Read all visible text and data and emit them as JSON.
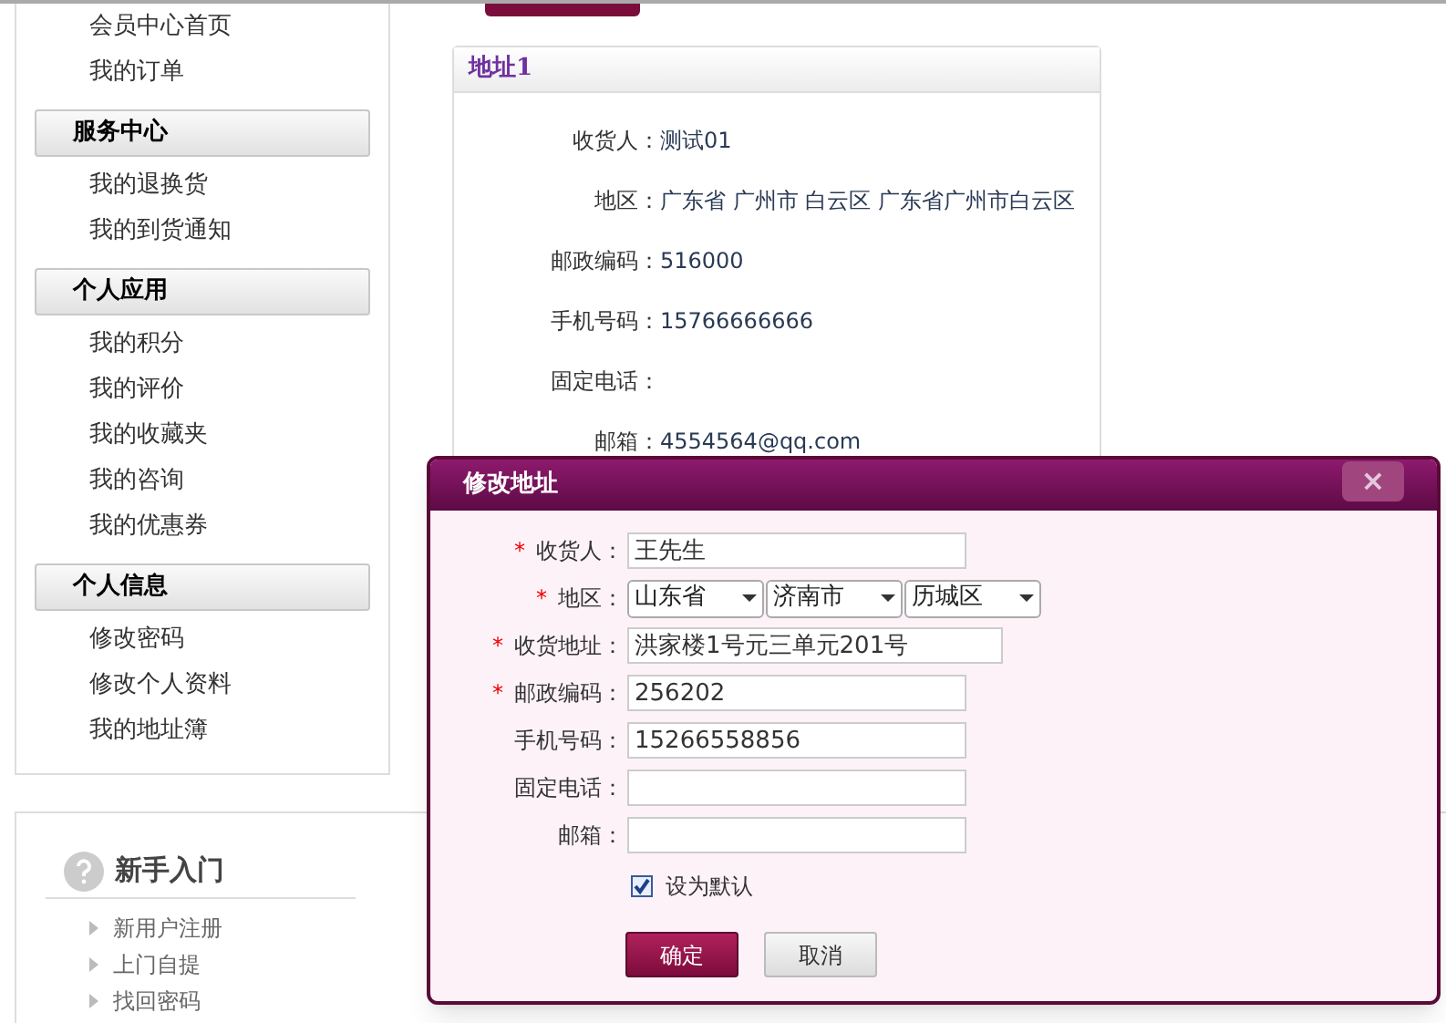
{
  "sidebar": {
    "top_links": [
      "会员中心首页",
      "我的订单"
    ],
    "sections": [
      {
        "title": "服务中心",
        "items": [
          "我的退换货",
          "我的到货通知"
        ]
      },
      {
        "title": "个人应用",
        "items": [
          "我的积分",
          "我的评价",
          "我的收藏夹",
          "我的咨询",
          "我的优惠券"
        ]
      },
      {
        "title": "个人信息",
        "items": [
          "修改密码",
          "修改个人资料",
          "我的地址簿"
        ]
      }
    ]
  },
  "address_card": {
    "title": "地址1",
    "fields": [
      {
        "label": "收货人：",
        "value": "测试01"
      },
      {
        "label": "地区：",
        "value": "广东省 广州市 白云区 广东省广州市白云区"
      },
      {
        "label": "邮政编码：",
        "value": "516000"
      },
      {
        "label": "手机号码：",
        "value": "15766666666"
      },
      {
        "label": "固定电话："
      },
      {
        "label": "邮箱：",
        "value": "4554564@qq.com"
      }
    ]
  },
  "help_section": {
    "title": "新手入门",
    "items": [
      "新用户注册",
      "上门自提",
      "找回密码"
    ]
  },
  "dialog": {
    "title": "修改地址",
    "close": "×",
    "fields": [
      {
        "kind": "text",
        "required_mark": "*",
        "label": "收货人：",
        "value": "王先生"
      },
      {
        "kind": "select",
        "required_mark": "*",
        "label": "地区：",
        "options": [
          "山东省",
          "济南市",
          "历城区"
        ]
      },
      {
        "kind": "wide_text",
        "required_mark": "*",
        "label": "收货地址：",
        "value": "洪家楼1号元三单元201号"
      },
      {
        "kind": "text",
        "required_mark": "*",
        "label": "邮政编码：",
        "value": "256202"
      },
      {
        "kind": "text",
        "label": "手机号码：",
        "value": "15266558856"
      },
      {
        "kind": "text",
        "label": "固定电话："
      },
      {
        "kind": "text",
        "label": "邮箱："
      }
    ],
    "default_checkbox": {
      "label": "设为默认",
      "checked": true
    },
    "buttons": [
      {
        "kind": "primary",
        "label": "确定"
      },
      {
        "kind": "secondary",
        "label": "取消"
      }
    ]
  }
}
